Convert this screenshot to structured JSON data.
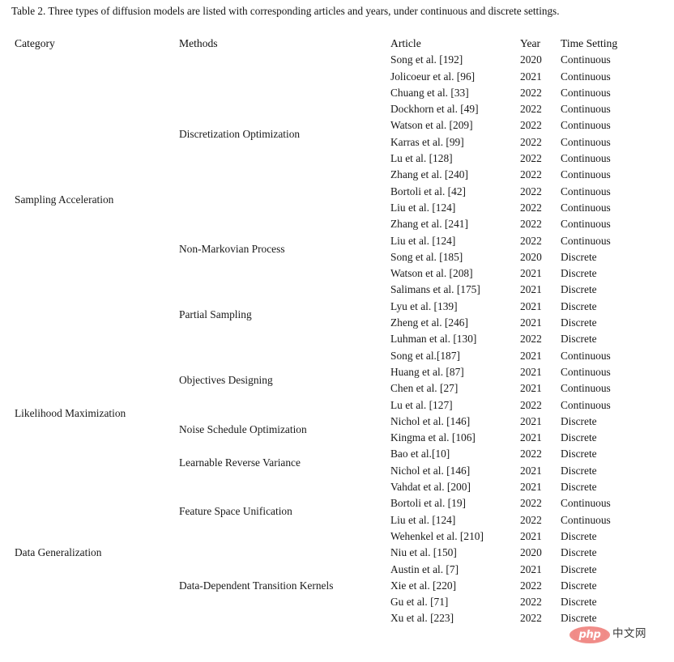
{
  "caption": {
    "label": "Table 2.",
    "text": "Three types of diffusion models are listed with corresponding articles and years, under continuous and discrete settings."
  },
  "table": {
    "columns": [
      "Category",
      "Methods",
      "Article",
      "Year",
      "Time Setting"
    ],
    "sections": [
      {
        "category": "Sampling Acceleration",
        "groups": [
          {
            "method": "Discretization Optimization",
            "rows": [
              {
                "article": "Song et al. [192]",
                "year": "2020",
                "time": "Continuous"
              },
              {
                "article": "Jolicoeur et al. [96]",
                "year": "2021",
                "time": "Continuous"
              },
              {
                "article": "Chuang et al. [33]",
                "year": "2022",
                "time": "Continuous"
              },
              {
                "article": "Dockhorn et al. [49]",
                "year": "2022",
                "time": "Continuous"
              },
              {
                "article": "Watson et al. [209]",
                "year": "2022",
                "time": "Continuous"
              },
              {
                "article": "Karras et al. [99]",
                "year": "2022",
                "time": "Continuous"
              },
              {
                "article": "Lu et al. [128]",
                "year": "2022",
                "time": "Continuous"
              },
              {
                "article": "Zhang et al. [240]",
                "year": "2022",
                "time": "Continuous"
              },
              {
                "article": "Bortoli et al. [42]",
                "year": "2022",
                "time": "Continuous"
              },
              {
                "article": "Liu et al. [124]",
                "year": "2022",
                "time": "Continuous"
              }
            ]
          },
          {
            "method": "Non-Markovian Process",
            "rows": [
              {
                "article": "Zhang et al. [241]",
                "year": "2022",
                "time": "Continuous"
              },
              {
                "article": "Liu et al. [124]",
                "year": "2022",
                "time": "Continuous"
              },
              {
                "article": "Song et al. [185]",
                "year": "2020",
                "time": "Discrete"
              },
              {
                "article": "Watson et al. [208]",
                "year": "2021",
                "time": "Discrete"
              }
            ]
          },
          {
            "method": "Partial Sampling",
            "rows": [
              {
                "article": "Salimans et al. [175]",
                "year": "2021",
                "time": "Discrete"
              },
              {
                "article": "Lyu et al. [139]",
                "year": "2021",
                "time": "Discrete"
              },
              {
                "article": "Zheng et al. [246]",
                "year": "2021",
                "time": "Discrete"
              },
              {
                "article": "Luhman et al. [130]",
                "year": "2022",
                "time": "Discrete"
              }
            ]
          }
        ]
      },
      {
        "category": "Likelihood Maximization",
        "groups": [
          {
            "method": "Objectives Designing",
            "rows": [
              {
                "article": "Song et al.[187]",
                "year": "2021",
                "time": "Continuous"
              },
              {
                "article": "Huang et al. [87]",
                "year": "2021",
                "time": "Continuous"
              },
              {
                "article": "Chen et al. [27]",
                "year": "2021",
                "time": "Continuous"
              },
              {
                "article": "Lu et al. [127]",
                "year": "2022",
                "time": "Continuous"
              }
            ]
          },
          {
            "method": "Noise Schedule Optimization",
            "rows": [
              {
                "article": "Nichol et al. [146]",
                "year": "2021",
                "time": "Discrete"
              },
              {
                "article": "Kingma et al. [106]",
                "year": "2021",
                "time": "Discrete"
              }
            ]
          },
          {
            "method": "Learnable Reverse Variance",
            "rows": [
              {
                "article": "Bao et al.[10]",
                "year": "2022",
                "time": "Discrete"
              },
              {
                "article": "Nichol et al. [146]",
                "year": "2021",
                "time": "Discrete"
              }
            ]
          }
        ]
      },
      {
        "category": "Data Generalization",
        "groups": [
          {
            "method": "Feature Space Unification",
            "rows": [
              {
                "article": "Vahdat et al. [200]",
                "year": "2021",
                "time": "Discrete"
              },
              {
                "article": "Bortoli et al. [19]",
                "year": "2022",
                "time": "Continuous"
              },
              {
                "article": "Liu et al. [124]",
                "year": "2022",
                "time": "Continuous"
              },
              {
                "article": "Wehenkel et al. [210]",
                "year": "2021",
                "time": "Discrete"
              }
            ]
          },
          {
            "method": "Data-Dependent Transition Kernels",
            "rows": [
              {
                "article": "Niu et al. [150]",
                "year": "2020",
                "time": "Discrete"
              },
              {
                "article": "Austin et al. [7]",
                "year": "2021",
                "time": "Discrete"
              },
              {
                "article": "Xie et al. [220]",
                "year": "2022",
                "time": "Discrete"
              },
              {
                "article": "Gu et al. [71]",
                "year": "2022",
                "time": "Discrete"
              },
              {
                "article": "Xu et al. [223]",
                "year": "2022",
                "time": "Discrete"
              }
            ]
          }
        ]
      }
    ]
  },
  "watermark": {
    "badge_text": "php",
    "cn_text": "中文网",
    "badge_color": "#ef8f8b"
  }
}
